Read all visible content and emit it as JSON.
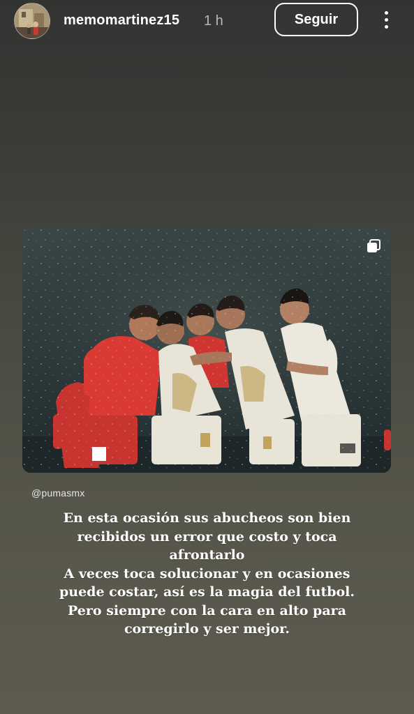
{
  "header": {
    "username": "memomartinez15",
    "time": "1 h",
    "follow_label": "Seguir"
  },
  "post": {
    "mention": "@pumasmx"
  },
  "caption": {
    "lines": [
      "En esta ocasión sus abucheos son bien",
      "recibidos un error que costo y toca",
      "afrontarlo",
      "A veces toca solucionar y en ocasiones",
      "puede costar, así es la magia del futbol.",
      "Pero siempre con la cara en alto para",
      "corregirlo y ser mejor."
    ]
  },
  "icons": {
    "more": "more-vertical-icon",
    "multi": "multiple-images-icon"
  },
  "colors": {
    "background_top": "#323432",
    "background_bottom": "#5d5b4f",
    "text": "#ffffff",
    "home_kit": "#e8e4d8",
    "away_kit": "#d93a34"
  }
}
